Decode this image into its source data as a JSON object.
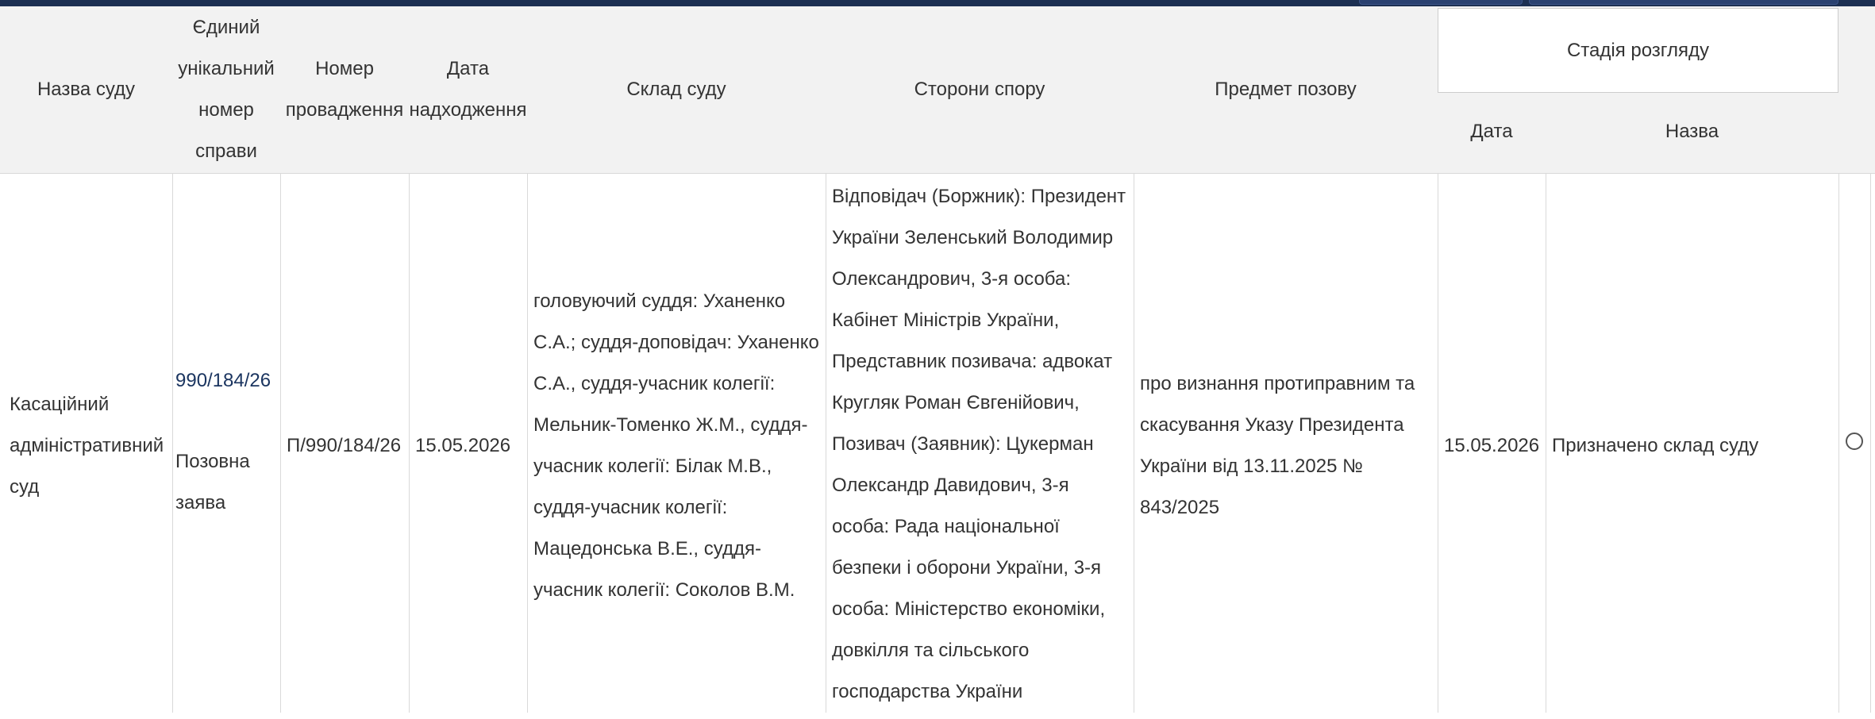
{
  "table": {
    "headers": {
      "court_name": "Назва суду",
      "case_number": "Єдиний унікальний номер справи",
      "proceeding_number": "Номер провадження",
      "receipt_date": "Дата надходження",
      "court_composition": "Склад суду",
      "parties": "Сторони спору",
      "subject": "Предмет позову",
      "stage": "Стадія розгляду",
      "stage_date": "Дата",
      "stage_name": "Назва"
    },
    "rows": [
      {
        "court_name": "Касаційний адміністративний суд",
        "case_number": "990/184/26",
        "case_type": "Позовна заява",
        "proceeding_number": "П/990/184/26",
        "receipt_date": "15.05.2026",
        "court_composition": "головуючий суддя: Уханенко С.А.; суддя-доповідач: Уханенко С.А., суддя-учасник колегії: Мельник-Томенко Ж.М., суддя-учасник колегії: Білак М.В., суддя-учасник колегії: Мацедонська В.Е., суддя-учасник колегії: Соколов В.М.",
        "parties": "Відповідач (Боржник): Президент України Зеленський Володимир Олександрович, 3-я особа: Кабінет Міністрів України, Представник позивача: адвокат Кругляк Роман Євгенійович, Позивач (Заявник): Цукерман Олександр Давидович, 3-я особа: Рада національної безпеки і оборони України, 3-я особа: Міністерство економіки, довкілля та сільського господарства України",
        "subject": "про визнання протиправним та скасування Указу Президента України від 13.11.2025 № 843/2025",
        "stage_date": "15.05.2026",
        "stage_name": "Призначено склад суду"
      }
    ]
  }
}
